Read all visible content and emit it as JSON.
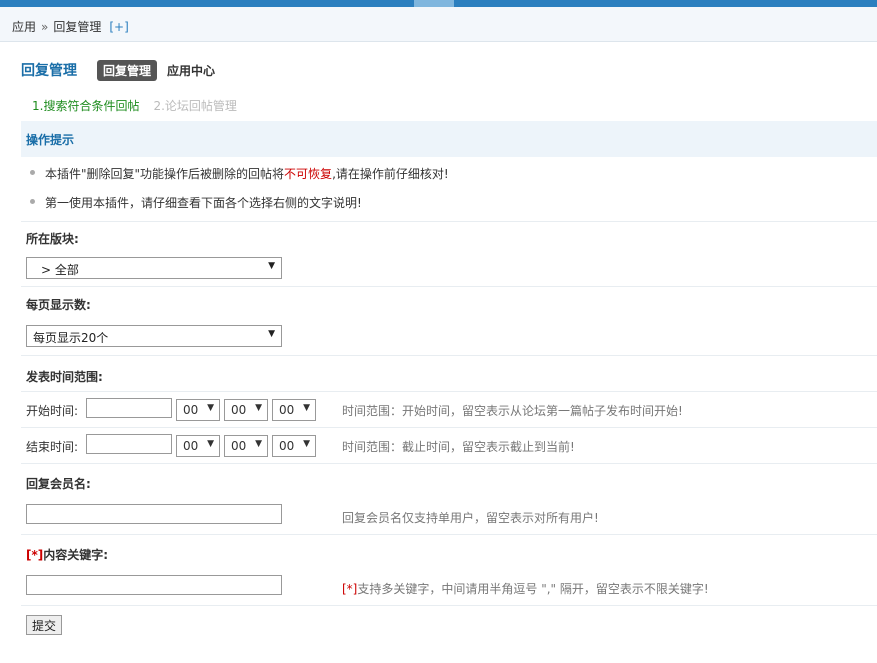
{
  "breadcrumb": {
    "root": "应用",
    "separator": "»",
    "current": "回复管理",
    "add": "[+]"
  },
  "header": {
    "title": "回复管理",
    "tabs": [
      {
        "label": "回复管理",
        "active": true
      },
      {
        "label": "应用中心",
        "active": false
      }
    ]
  },
  "steps": [
    {
      "label": "1.搜索符合条件回帖",
      "active": true
    },
    {
      "label": "2.论坛回帖管理",
      "active": false
    }
  ],
  "tips": {
    "title": "操作提示",
    "line1_prefix": "本插件\"删除回复\"功能操作后被删除的回帖将",
    "line1_warn": "不可恢复",
    "line1_suffix": ",请在操作前仔细核对!",
    "line2": "第一使用本插件，请仔细查看下面各个选择右侧的文字说明!"
  },
  "form": {
    "forum": {
      "label": "所在版块:",
      "value": "> 全部"
    },
    "per_page": {
      "label": "每页显示数:",
      "value": "每页显示20个"
    },
    "time_range": {
      "label": "发表时间范围:",
      "start": {
        "label": "开始时间:",
        "date": "",
        "hour": "00",
        "minute": "00",
        "second": "00",
        "hint": "时间范围：开始时间，留空表示从论坛第一篇帖子发布时间开始!"
      },
      "end": {
        "label": "结束时间:",
        "date": "",
        "hour": "00",
        "minute": "00",
        "second": "00",
        "hint": "时间范围：截止时间，留空表示截止到当前!"
      }
    },
    "member": {
      "label": "回复会员名:",
      "value": "",
      "hint": "回复会员名仅支持单用户，留空表示对所有用户!"
    },
    "keyword": {
      "required_mark": "[*]",
      "label": "内容关键字:",
      "value": "",
      "hint_mark": "[*]",
      "hint": "支持多关键字，中间请用半角逗号 \",\" 隔开，留空表示不限关键字!"
    },
    "submit": "提交"
  },
  "colors": {
    "accent": "#1a6ea8",
    "topbar": "#2b7fbf",
    "warn": "#cc0000",
    "step_active": "#1e8c1e"
  },
  "icons": {
    "dropdown": "▼"
  }
}
